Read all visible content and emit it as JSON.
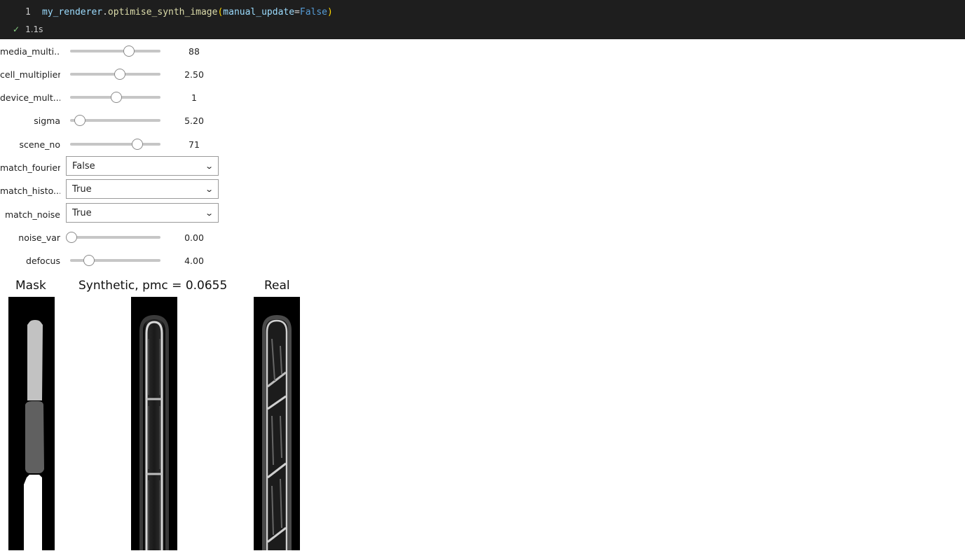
{
  "cell": {
    "line_number": "1",
    "code": {
      "obj": "my_renderer",
      "dot": ".",
      "method": "optimise_synth_image",
      "open": "(",
      "param": "manual_update",
      "eq": "=",
      "arg": "False",
      "close": ")"
    },
    "status_icon": "check-icon",
    "duration": "1.1s"
  },
  "widgets": {
    "media_multiplier": {
      "label": "media_multi...",
      "value": "88",
      "position": 0.65
    },
    "cell_multiplier": {
      "label": "cell_multiplier",
      "value": "2.50",
      "position": 0.55
    },
    "device_multiplier": {
      "label": "device_mult...",
      "value": "1",
      "position": 0.52
    },
    "sigma": {
      "label": "sigma",
      "value": "5.20",
      "position": 0.1
    },
    "scene_no": {
      "label": "scene_no",
      "value": "71",
      "position": 0.75
    },
    "match_fourier": {
      "label": "match_fourier",
      "value": "False"
    },
    "match_histogram": {
      "label": "match_histo...",
      "value": "True"
    },
    "match_noise": {
      "label": "match_noise",
      "value": "True"
    },
    "noise_var": {
      "label": "noise_var",
      "value": "0.00",
      "position": 0.0
    },
    "defocus": {
      "label": "defocus",
      "value": "4.00",
      "position": 0.2
    }
  },
  "figure": {
    "mask_title": "Mask",
    "synthetic_title": "Synthetic, pmc = 0.0655",
    "real_title": "Real"
  },
  "colors": {
    "code_bg": "#1e1e1e",
    "code_variable": "#9cdcfe",
    "code_function": "#dcdcaa",
    "code_paren": "#ffd700",
    "code_keyword": "#569cd6",
    "check": "#89d185"
  }
}
